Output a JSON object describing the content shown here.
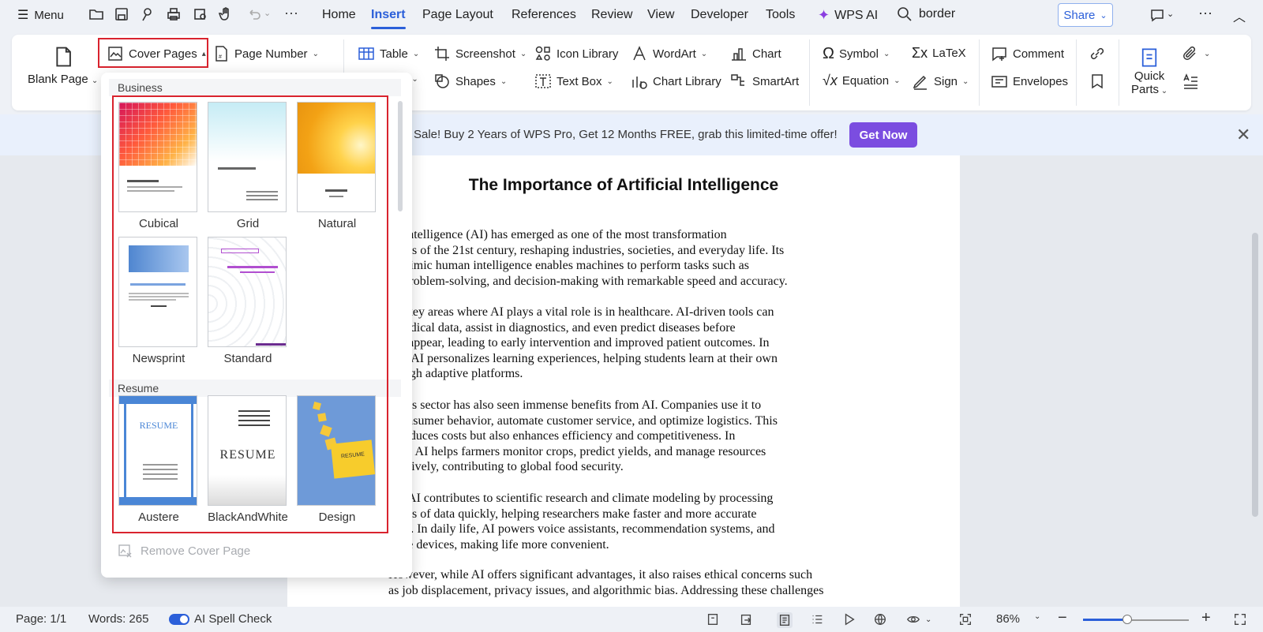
{
  "topbar": {
    "menu_label": "Menu",
    "tabs": [
      "Home",
      "Insert",
      "Page Layout",
      "References",
      "Review",
      "View",
      "Developer",
      "Tools"
    ],
    "active_tab": "Insert",
    "wps_ai": "WPS AI",
    "search_text": "border",
    "share_label": "Share"
  },
  "ribbon": {
    "blank_page": "Blank Page",
    "cover_pages": "Cover Pages",
    "page_number": "Page Number",
    "table": "Table",
    "picture_partial": "e",
    "screenshot": "Screenshot",
    "shapes": "Shapes",
    "icon_library": "Icon  Library",
    "text_box": "Text Box",
    "wordart": "WordArt",
    "chart_library": "Chart  Library",
    "chart": "Chart",
    "smartart": "SmartArt",
    "symbol": "Symbol",
    "equation": "Equation",
    "latex": "LaTeX",
    "sign": "Sign",
    "comment": "Comment",
    "envelopes": "Envelopes",
    "quick_parts": "Quick",
    "quick_parts_2": "Parts"
  },
  "promo": {
    "text": "Sale! Buy 2 Years of WPS Pro, Get 12 Months FREE, grab this limited-time offer!",
    "button": "Get Now"
  },
  "document": {
    "title": "The Importance of Artificial Intelligence",
    "paragraphs": [
      "ficial Intelligence (AI) has emerged as one of the most transformation\nnologies of the 21st century, reshaping industries, societies, and everyday life. Its\nty to mimic human intelligence enables machines to perform tasks such as\nning, problem-solving, and decision-making with remarkable speed and accuracy.",
      "of the key areas where AI plays a vital role is in healthcare. AI-driven tools can\nyze medical data, assist in diagnostics, and even predict diseases before\nptoms appear, leading to early intervention and improved patient outcomes. In\ncation, AI personalizes learning experiences, helping students learn at their own\ne through adaptive platforms.",
      "business sector has also seen immense benefits from AI. Companies use it to\nyze consumer behavior, automate customer service, and optimize logistics. This\nonly reduces costs but also enhances efficiency and competitiveness. In\nculture, AI helps farmers monitor crops, predict yields, and manage resources\ne effectively, contributing to global food security.",
      "eover, AI contributes to scientific research and climate modeling by processing\namounts of data quickly, helping researchers make faster and more accurate\noveries. In daily life, AI powers voice assistants, recommendation systems, and\nrt home devices, making life more convenient.",
      "However, while AI offers significant advantages, it also raises ethical concerns such\nas job displacement, privacy issues, and algorithmic bias. Addressing these challenges"
    ]
  },
  "dropdown": {
    "section_business": "Business",
    "section_resume": "Resume",
    "business_items": [
      "Cubical",
      "Grid",
      "Natural",
      "Newsprint",
      "Standard"
    ],
    "resume_items": [
      "Austere",
      "BlackAndWhite",
      "Design"
    ],
    "remove_label": "Remove Cover Page"
  },
  "status": {
    "page": "Page: 1/1",
    "words": "Words: 265",
    "spell_check": "AI Spell Check",
    "zoom": "86%",
    "zoom_fraction": 0.42
  }
}
